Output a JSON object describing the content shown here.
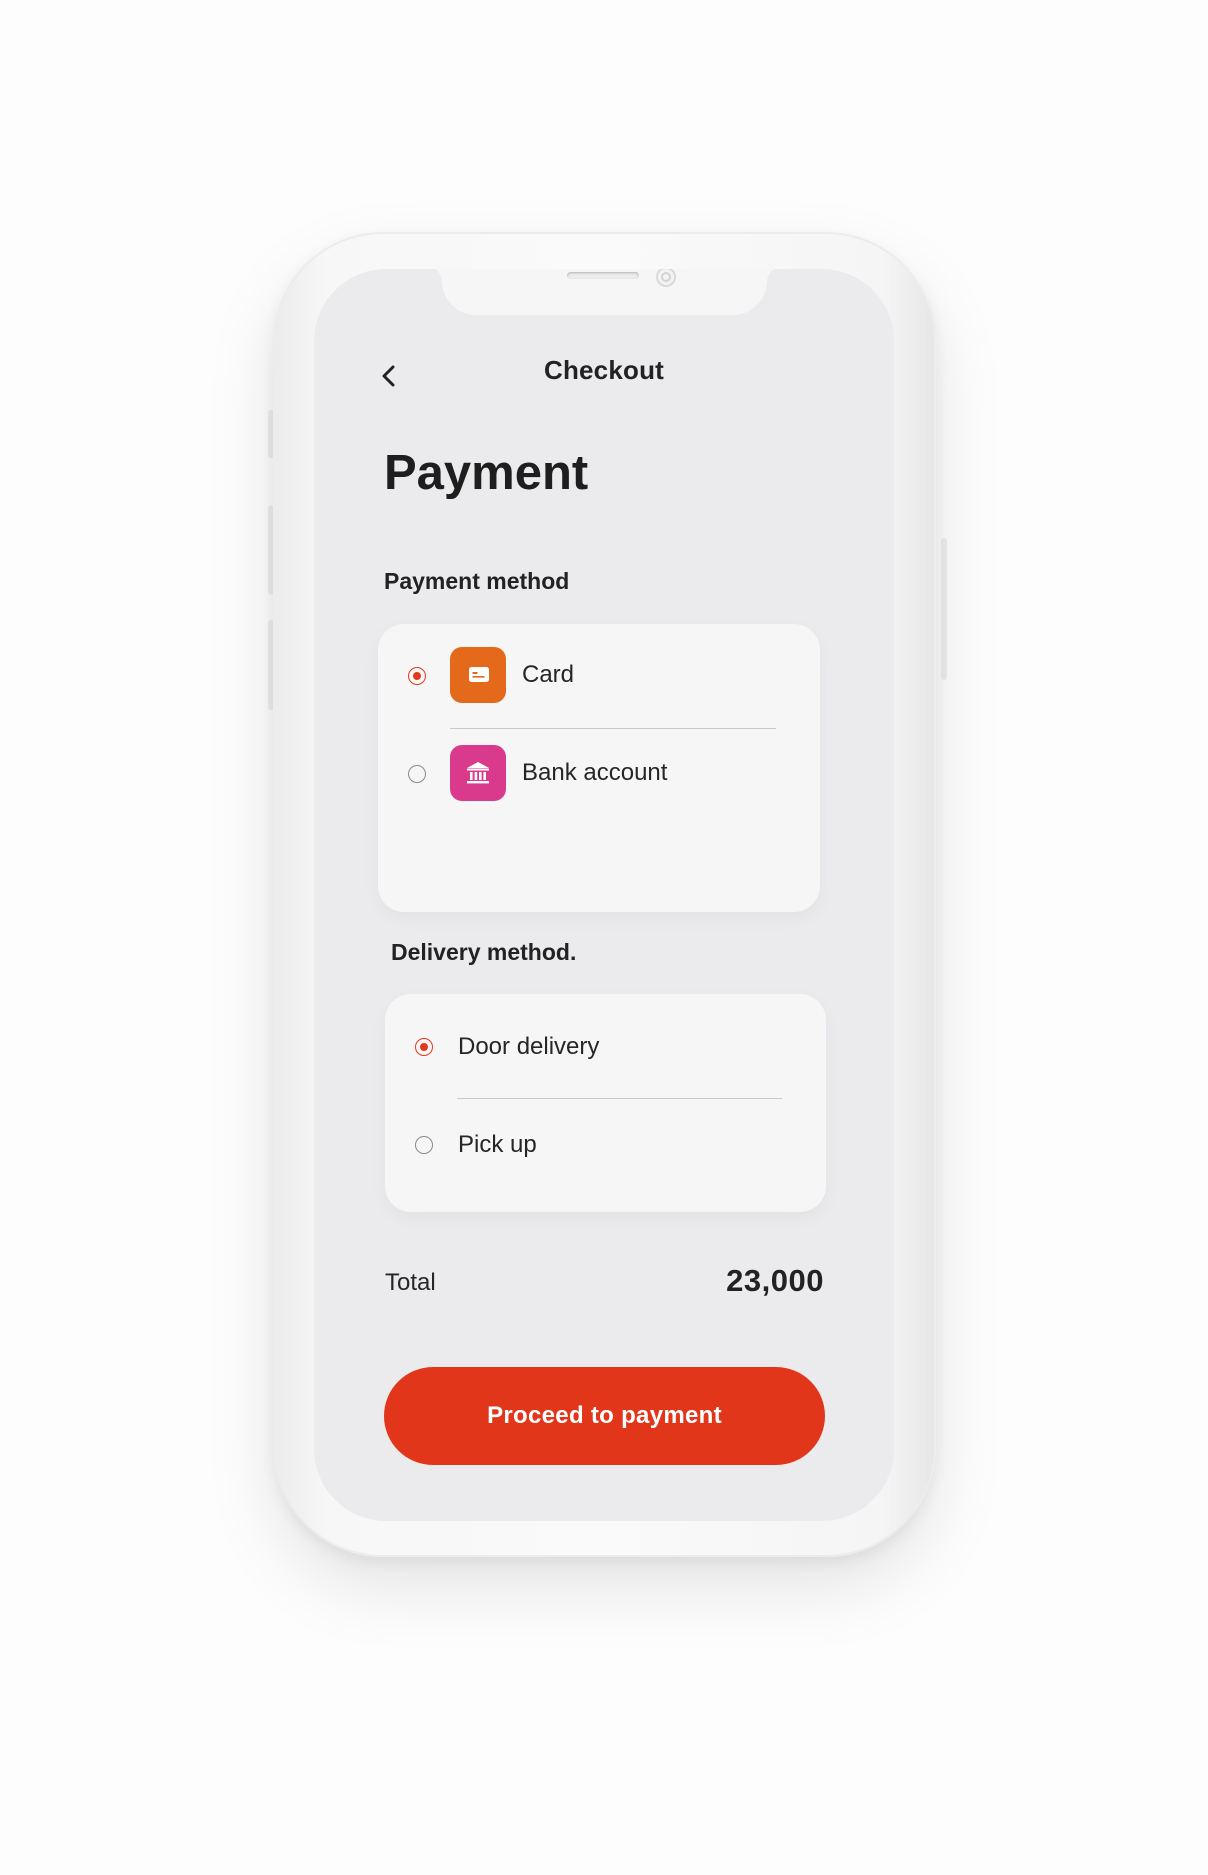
{
  "header": {
    "title": "Checkout",
    "back_icon": "chevron-left-icon"
  },
  "page": {
    "title": "Payment"
  },
  "payment": {
    "section_label": "Payment method",
    "options": [
      {
        "label": "Card",
        "selected": true,
        "icon": "credit-card-icon",
        "icon_color": "#e5691b"
      },
      {
        "label": "Bank account",
        "selected": false,
        "icon": "bank-icon",
        "icon_color": "#d93a8c"
      }
    ]
  },
  "delivery": {
    "section_label": "Delivery method.",
    "options": [
      {
        "label": "Door delivery",
        "selected": true
      },
      {
        "label": "Pick up",
        "selected": false
      }
    ]
  },
  "summary": {
    "total_label": "Total",
    "total_value": "23,000"
  },
  "cta": {
    "label": "Proceed to payment"
  },
  "colors": {
    "accent": "#e2361b",
    "screen_bg": "#ebebee",
    "card_bg": "#f6f6f6"
  }
}
